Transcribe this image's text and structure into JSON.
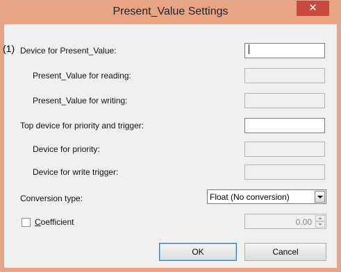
{
  "window": {
    "title": "Present_Value Settings",
    "close_glyph": "✕"
  },
  "marker": "(1)",
  "fields": {
    "device_present_value": {
      "label": "Device for Present_Value:",
      "value": ""
    },
    "pv_reading": {
      "label": "Present_Value for reading:",
      "value": ""
    },
    "pv_writing": {
      "label": "Present_Value for writing:",
      "value": ""
    },
    "top_device": {
      "label": "Top device for priority and trigger:",
      "value": ""
    },
    "priority_device": {
      "label": "Device for priority:",
      "value": ""
    },
    "write_trigger_device": {
      "label": "Device for write trigger:",
      "value": ""
    }
  },
  "conversion": {
    "label": "Conversion type:",
    "selected": "Float (No conversion)"
  },
  "coefficient": {
    "label_prefix": "C",
    "label_rest": "oefficient",
    "checked": false,
    "value": "0.00"
  },
  "buttons": {
    "ok": "OK",
    "cancel": "Cancel"
  },
  "colors": {
    "frame": "#e9a486",
    "close": "#c84a3e",
    "client": "#f0f0f0"
  },
  "icons": {
    "close": "close-icon",
    "dropdown": "chevron-down-icon",
    "spin_up": "spin-up-icon",
    "spin_down": "spin-down-icon"
  }
}
